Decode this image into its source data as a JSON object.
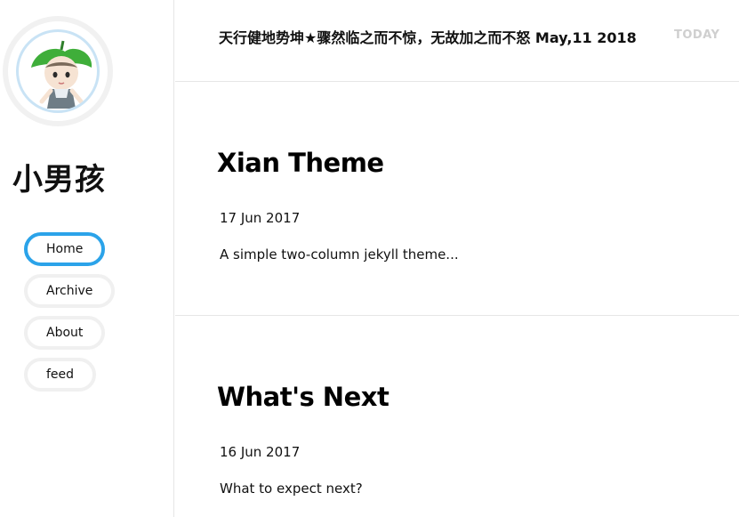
{
  "sidebar": {
    "avatar_alt": "avatar",
    "site_title": "小男孩",
    "nav": [
      {
        "label": "Home",
        "active": true
      },
      {
        "label": "Archive",
        "active": false
      },
      {
        "label": "About",
        "active": false
      },
      {
        "label": "feed",
        "active": false
      }
    ]
  },
  "header": {
    "motto": "天行健地势坤★骤然临之而不惊，无故加之而不怒 May,11 2018",
    "today_label": "TODAY"
  },
  "posts": [
    {
      "title": "Xian Theme",
      "date": "17 Jun 2017",
      "excerpt": "A simple two-column jekyll theme..."
    },
    {
      "title": "What's Next",
      "date": "16 Jun 2017",
      "excerpt": "What to expect next?"
    }
  ],
  "colors": {
    "accent": "#2ba3e9",
    "border": "#e6e6e6",
    "today": "#cfcfcf"
  }
}
